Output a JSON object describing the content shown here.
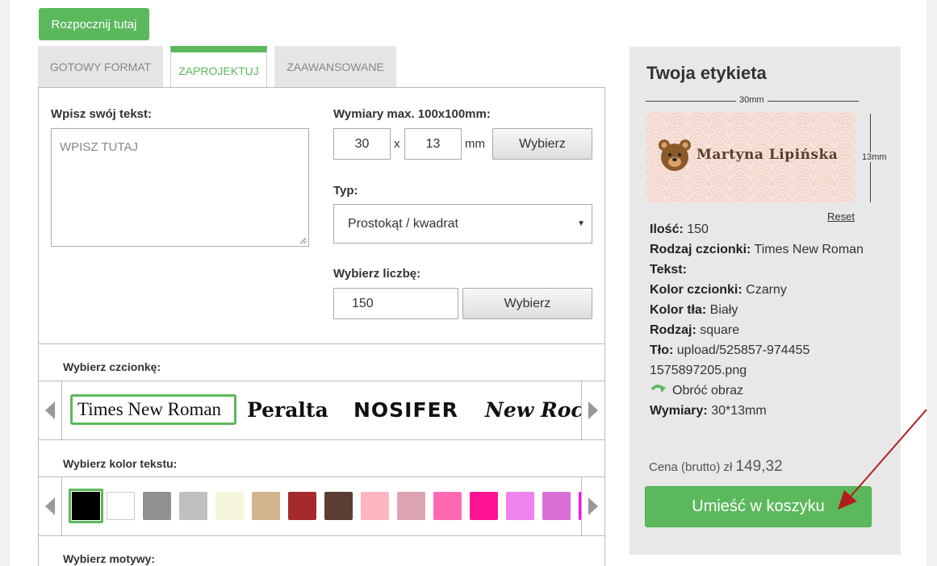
{
  "start_button": "Rozpocznij tutaj",
  "tabs": [
    "GOTOWY FORMAT",
    "ZAPROJEKTUJ",
    "ZAAWANSOWANE"
  ],
  "form": {
    "text_label": "Wpisz swój tekst:",
    "text_placeholder": "WPISZ TUTAJ",
    "dims_label": "Wymiary max. 100x100mm:",
    "width": "30",
    "times": "x",
    "height": "13",
    "unit": "mm",
    "choose": "Wybierz",
    "type_label": "Typ:",
    "type_value": "Prostokąt / kwadrat",
    "count_label": "Wybierz liczbę:",
    "count_value": "150",
    "choose2": "Wybierz"
  },
  "fonts": {
    "label": "Wybierz czcionkę:",
    "items": [
      "Times New Roman",
      "Peralta",
      "NOSIFER",
      "New Rocker"
    ]
  },
  "text_colors": {
    "label": "Wybierz kolor tekstu:",
    "swatches": [
      "#000000",
      "#ffffff",
      "#909090",
      "#c0c0c0",
      "#f5f5dc",
      "#d2b48c",
      "#a52a2a",
      "#5c3d33",
      "#ffb6c1",
      "#dba4b0",
      "#ff69b4",
      "#ff1493",
      "#ee82ee",
      "#da70d6",
      "#ff00ff"
    ]
  },
  "motifs": {
    "label": "Wybierz motywy:"
  },
  "sidebar": {
    "title": "Twoja etykieta",
    "dim_width": "30mm",
    "dim_height": "13mm",
    "label_text": "Martyna Lipińska",
    "reset": "Reset",
    "info": {
      "qty_k": "Ilość:",
      "qty_v": "150",
      "font_k": "Rodzaj czcionki:",
      "font_v": "Times New Roman",
      "text_k": "Tekst:",
      "color_k": "Kolor czcionki:",
      "color_v": "Czarny",
      "bg_k": "Kolor tła:",
      "bg_v": "Biały",
      "kind_k": "Rodzaj:",
      "kind_v": "square",
      "bgimg_k": "Tło:",
      "bgimg_v": "upload/525857-9744551575897205.png",
      "rotate": "Obróć obraz",
      "dims_k": "Wymiary:",
      "dims_v": "30*13mm"
    },
    "price_label": "Cena (brutto) zł",
    "price_value": "149,32",
    "cart_button": "Umieść w koszyku"
  },
  "colors": {
    "accent": "#5cb85c",
    "annotation_arrow": "#b01c1c"
  }
}
